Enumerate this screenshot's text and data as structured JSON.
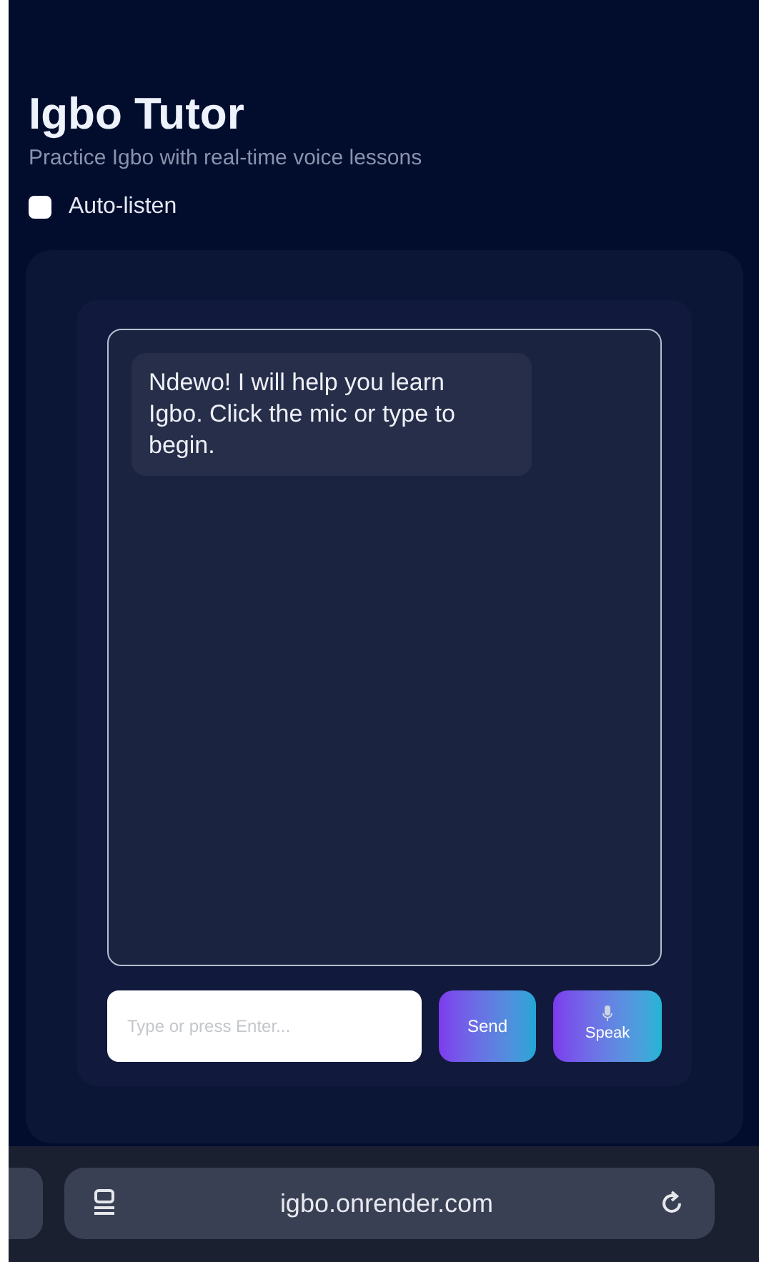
{
  "header": {
    "title": "Igbo Tutor",
    "subtitle": "Practice Igbo with real-time voice lessons"
  },
  "auto_listen": {
    "label": "Auto-listen",
    "checked": false
  },
  "messages": [
    {
      "kind": "tutor",
      "text": "Ndewo! I will help you learn Igbo. Click the mic or type to begin."
    }
  ],
  "composer": {
    "placeholder": "Type or press Enter...",
    "send": "Send",
    "speak": "Speak"
  },
  "browser_bar": {
    "url": "igbo.onrender.com"
  }
}
